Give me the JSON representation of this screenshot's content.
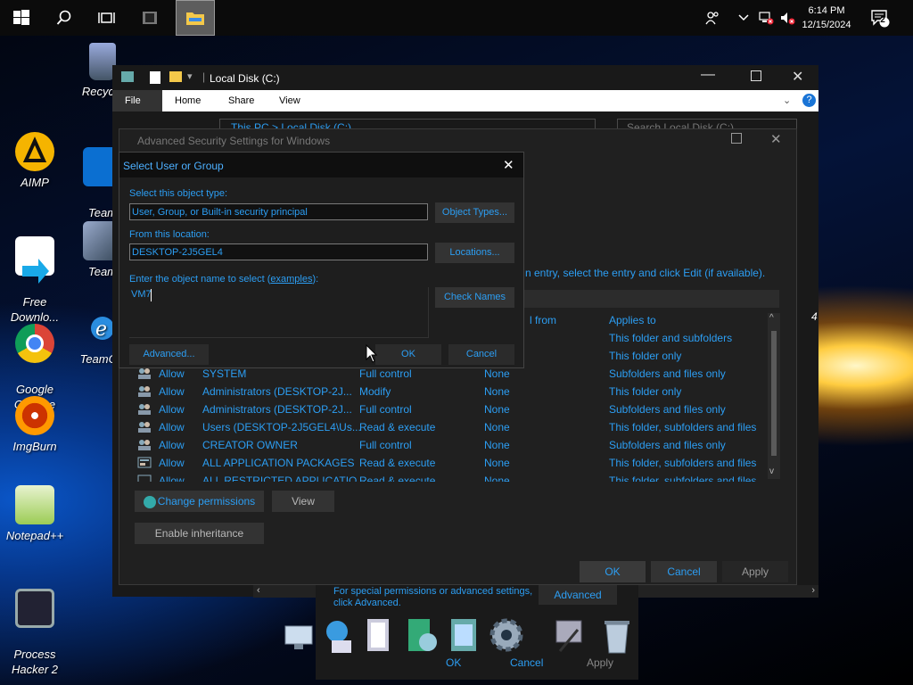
{
  "taskbar": {
    "clock_time": "6:14 PM",
    "clock_date": "12/15/2024",
    "notification_count": "2",
    "icons": [
      "windows-logo-icon",
      "search-icon",
      "task-view-icon",
      "app-icon",
      "file-explorer-icon"
    ]
  },
  "desktop_icons": [
    {
      "label": "Recycle",
      "name": "recycle-bin"
    },
    {
      "label": "AIMP",
      "name": "aimp"
    },
    {
      "label": "Team\nFaceb",
      "name": "team-facebook"
    },
    {
      "label": "Free\nDownlo...",
      "name": "free-download"
    },
    {
      "label": "Team",
      "name": "team"
    },
    {
      "label": "Google\nChrome",
      "name": "google-chrome"
    },
    {
      "label": "TeamOS",
      "name": "teamos"
    },
    {
      "label": "ImgBurn",
      "name": "imgburn"
    },
    {
      "label": "Notepad++",
      "name": "notepadpp"
    },
    {
      "label": "Process\nHacker 2",
      "name": "process-hacker"
    }
  ],
  "explorer": {
    "title": "Local Disk (C:)",
    "tabs": [
      "File",
      "Home",
      "Share",
      "View"
    ],
    "breadcrumb": "This PC > Local Disk (C:)",
    "search_placeholder": "Search Local Disk (C:)"
  },
  "advanced_security": {
    "title": "Advanced Security Settings for Windows",
    "hint": "n entry, select the entry and click Edit (if available).",
    "columns": {
      "inherited_from": "l from",
      "applies_to": "Applies to"
    },
    "entries": [
      {
        "type": "",
        "principal": "",
        "access": "",
        "inherited": "",
        "applies": "This folder and subfolders"
      },
      {
        "type": "",
        "principal": "",
        "access": "",
        "inherited": "",
        "applies": "This folder only"
      },
      {
        "type": "Allow",
        "principal": "SYSTEM",
        "access": "Full control",
        "inherited": "None",
        "applies": "Subfolders and files only"
      },
      {
        "type": "Allow",
        "principal": "Administrators (DESKTOP-2J...",
        "access": "Modify",
        "inherited": "None",
        "applies": "This folder only"
      },
      {
        "type": "Allow",
        "principal": "Administrators (DESKTOP-2J...",
        "access": "Full control",
        "inherited": "None",
        "applies": "Subfolders and files only"
      },
      {
        "type": "Allow",
        "principal": "Users (DESKTOP-2J5GEL4\\Us...",
        "access": "Read & execute",
        "inherited": "None",
        "applies": "This folder, subfolders and files"
      },
      {
        "type": "Allow",
        "principal": "CREATOR OWNER",
        "access": "Full control",
        "inherited": "None",
        "applies": "Subfolders and files only"
      },
      {
        "type": "Allow",
        "principal": "ALL APPLICATION PACKAGES",
        "access": "Read & execute",
        "inherited": "None",
        "applies": "This folder, subfolders and files"
      },
      {
        "type": "Allow",
        "principal": "ALL RESTRICTED APPLICATIO...",
        "access": "Read & execute",
        "inherited": "None",
        "applies": "This folder, subfolders and files"
      }
    ],
    "change_permissions": "Change permissions",
    "view": "View",
    "enable_inheritance": "Enable inheritance",
    "ok": "OK",
    "cancel": "Cancel",
    "apply": "Apply"
  },
  "select_user": {
    "title": "Select User or Group",
    "object_type_label": "Select this object type:",
    "object_type_value": "User, Group, or Built-in security principal",
    "object_types_button": "Object Types...",
    "location_label": "From this location:",
    "location_value": "DESKTOP-2J5GEL4",
    "locations_button": "Locations...",
    "name_label_prefix": "Enter the object name to select (",
    "name_label_link": "examples",
    "name_label_suffix": "):",
    "name_value": "VM7",
    "check_names_button": "Check Names",
    "advanced_button": "Advanced...",
    "ok_button": "OK",
    "cancel_button": "Cancel"
  },
  "bottom_panel": {
    "note": "For special permissions or advanced settings, click Advanced.",
    "advanced": "Advanced",
    "ok": "OK",
    "cancel": "Cancel",
    "apply": "Apply"
  },
  "side_fragment": "4"
}
